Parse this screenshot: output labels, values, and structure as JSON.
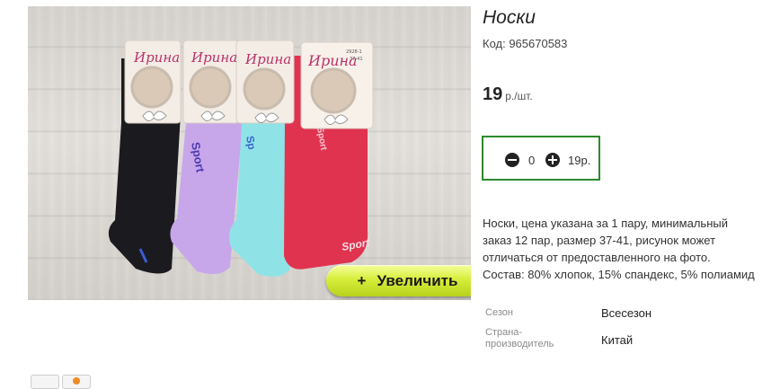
{
  "product": {
    "title": "Носки",
    "code_label": "Код: 965670583",
    "price": "19",
    "price_unit": "р./шт.",
    "quantity": "0",
    "total": "19р.",
    "zoom_plus": "+",
    "zoom_label": "Увеличить",
    "description": [
      "Носки, цена указана за 1 пару, минимальный",
      "заказ 12 пар, размер 37-41, рисунок может",
      "отличаться от предоставленного на фото.",
      "Состав: 80% хлопок, 15% спандекс, 5% полиамид"
    ],
    "specs": {
      "season_label": "Сезон",
      "season_value": "Всесезон",
      "country_label": "Страна-\nпроизводитель",
      "country_value": "Китай"
    }
  },
  "photo": {
    "brand": "Ирина",
    "model": "2928-1",
    "size": "37-41",
    "print": "Sport",
    "sock_colors": [
      "#1b1b1f",
      "#c8a6ea",
      "#8fe3e6",
      "#e0334f"
    ],
    "accent_color": "#2c8a2c",
    "button_color": "#cde632"
  }
}
